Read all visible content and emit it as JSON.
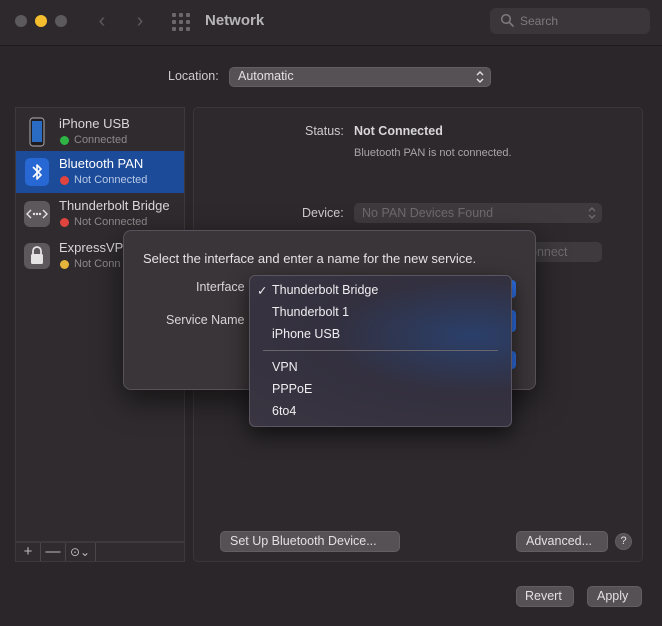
{
  "window": {
    "title": "Network"
  },
  "search": {
    "placeholder": "Search"
  },
  "location": {
    "label": "Location:",
    "value": "Automatic"
  },
  "services": [
    {
      "name": "iPhone USB",
      "status": "Connected",
      "status_color": "#2fb344",
      "selected": false,
      "icon": "iphone-icon"
    },
    {
      "name": "Bluetooth PAN",
      "status": "Not Connected",
      "status_color": "#e0443e",
      "selected": true,
      "icon": "bluetooth-icon"
    },
    {
      "name": "Thunderbolt Bridge",
      "status": "Not Connected",
      "status_color": "#e0443e",
      "selected": false,
      "icon": "thunderbolt-bridge-icon"
    },
    {
      "name": "ExpressVP",
      "status": "Not Conn",
      "status_color": "#e5b43a",
      "selected": false,
      "icon": "lock-icon"
    }
  ],
  "list_toolbar": {
    "add": "+",
    "remove": "—",
    "action": "⊙⌄"
  },
  "detail": {
    "status_label": "Status:",
    "status_value": "Not Connected",
    "status_desc": "Bluetooth PAN is not connected.",
    "device_label": "Device:",
    "device_value": "No PAN Devices Found",
    "connect_label": "onnect",
    "setup_button": "Set Up Bluetooth Device...",
    "advanced_button": "Advanced...",
    "help": "?"
  },
  "footer": {
    "revert": "Revert",
    "apply": "Apply"
  },
  "sheet": {
    "prompt": "Select the interface and enter a name for the new service.",
    "interface_label": "Interface",
    "service_name_label": "Service Name"
  },
  "popup_menu": {
    "check": "✓",
    "group1": [
      "Thunderbolt Bridge",
      "Thunderbolt 1",
      "iPhone USB"
    ],
    "group2": [
      "VPN",
      "PPPoE",
      "6to4"
    ],
    "selected": "Thunderbolt Bridge"
  },
  "colors": {
    "accent": "#1b4b99",
    "menu_highlight": "#2d6ee3",
    "minimize": "#f5be2f"
  }
}
